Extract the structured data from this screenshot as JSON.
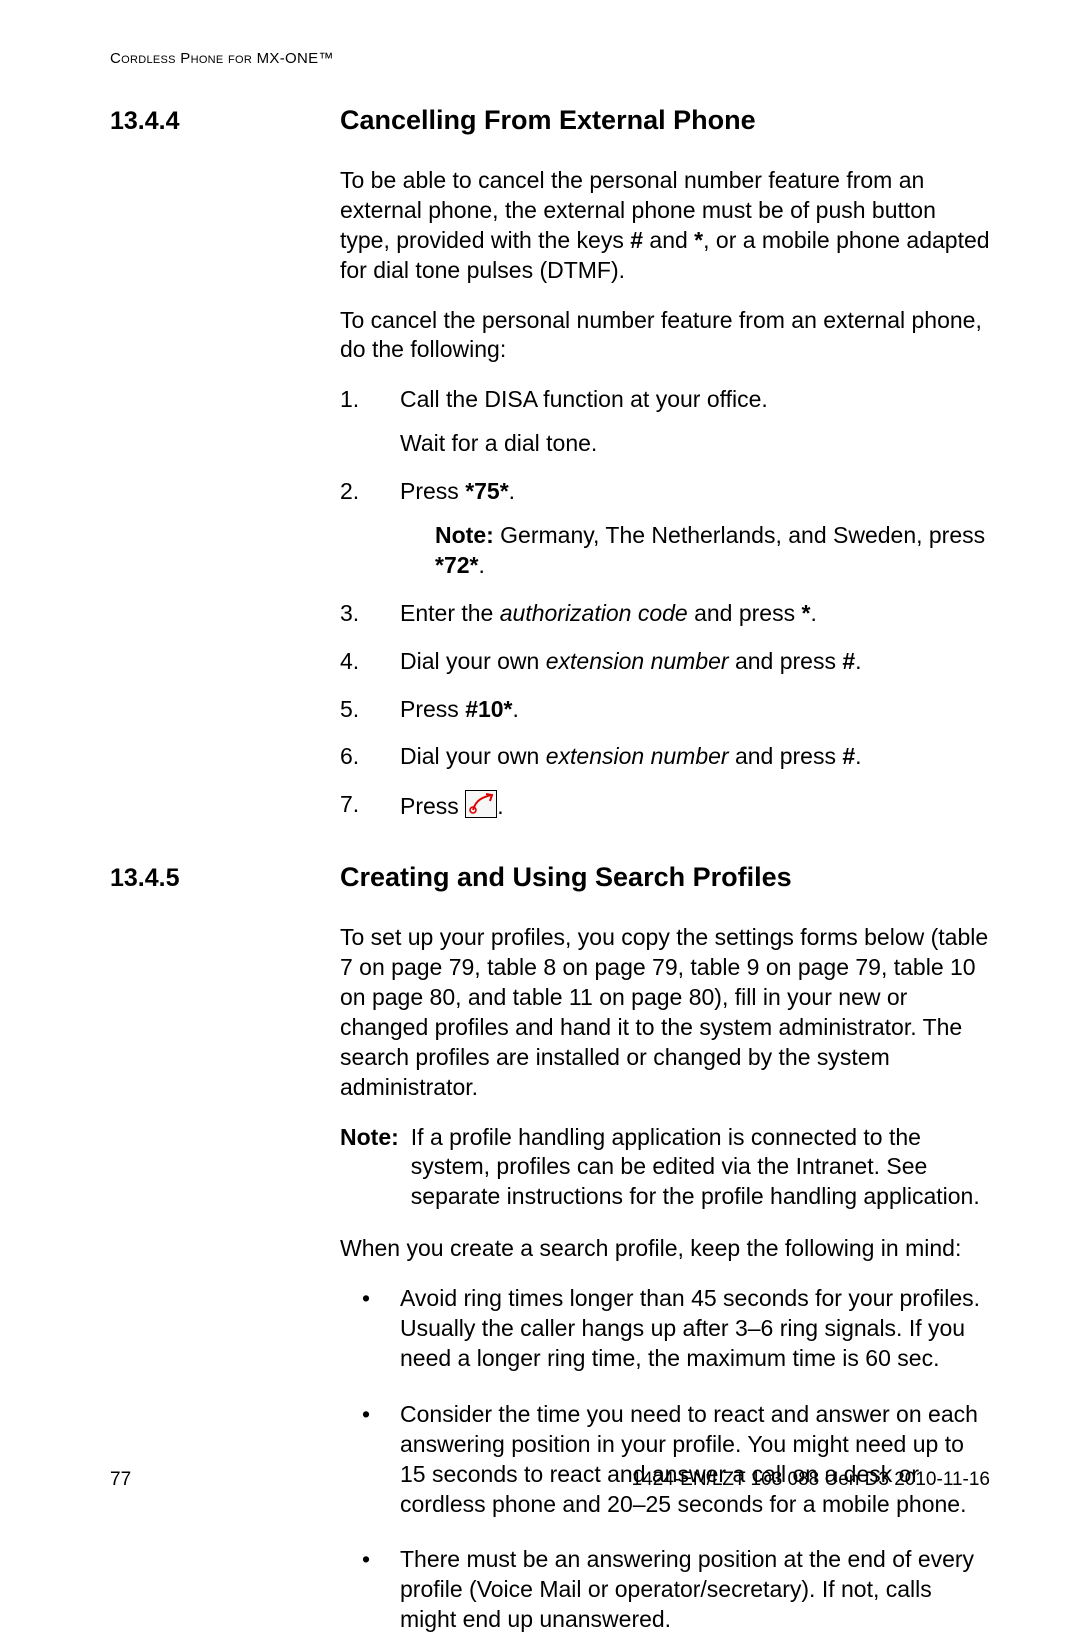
{
  "running_head": "Cordless Phone for MX-ONE™",
  "sections": {
    "s1": {
      "num": "13.4.4",
      "title": "Cancelling From External Phone",
      "intro1_a": "To be able to cancel the personal number feature from an external phone, the external phone must be of push button type, provided with the keys ",
      "intro1_hash": "#",
      "intro1_and": " and ",
      "intro1_star": "*",
      "intro1_b": ", or a mobile phone adapted for dial tone pulses (DTMF).",
      "intro2": "To cancel the personal number feature from an external phone, do the following:",
      "steps": {
        "s1_num": "1.",
        "s1_text": "Call the DISA function at your office.",
        "s1_sub": "Wait for a dial tone.",
        "s2_num": "2.",
        "s2_text_a": "Press ",
        "s2_code": "*75*",
        "s2_text_b": ".",
        "s2_note_label": "Note:",
        "s2_note_a": "  Germany, The Netherlands, and Sweden, press ",
        "s2_note_code": "*72*",
        "s2_note_b": ".",
        "s3_num": "3.",
        "s3_a": "Enter the ",
        "s3_i": "authorization code",
        "s3_b": " and press ",
        "s3_c": "*",
        "s3_d": ".",
        "s4_num": "4.",
        "s4_a": "Dial your own ",
        "s4_i": "extension number",
        "s4_b": " and press ",
        "s4_c": "#",
        "s4_d": ".",
        "s5_num": "5.",
        "s5_a": "Press ",
        "s5_code": "#10*",
        "s5_b": ".",
        "s6_num": "6.",
        "s6_a": "Dial your own ",
        "s6_i": "extension number",
        "s6_b": " and press ",
        "s6_c": "#",
        "s6_d": ".",
        "s7_num": "7.",
        "s7_a": "Press ",
        "s7_b": "."
      }
    },
    "s2": {
      "num": "13.4.5",
      "title": "Creating and Using Search Profiles",
      "intro1": "To set up your profiles, you copy the settings forms below (table 7 on page 79, table 8 on page 79, table 9 on page 79, table 10 on page 80, and table 11 on page 80), fill in your new or changed profiles and hand it to the system administrator. The search profiles are installed or changed by the system administrator.",
      "note_label": "Note:",
      "note_text": "If a profile handling application is connected to the system, profiles can be edited via the Intranet. See separate instructions for the profile handling application.",
      "intro2": "When you create a search profile, keep the following in mind:",
      "bullets": {
        "b1": "Avoid ring times longer than 45 seconds for your profiles. Usually the caller hangs up after 3–6 ring signals. If you need a longer ring time, the maximum time is 60 sec.",
        "b2": "Consider the time you need to react and answer on each answering position in your profile. You might need up to 15 seconds to react and answer a call on a desk or cordless phone and 20–25 seconds for a mobile phone.",
        "b3": "There must be an answering position at the end of every profile (Voice Mail or operator/secretary). If not, calls might end up unanswered."
      }
    }
  },
  "footer": {
    "page": "77",
    "docid": "1424-EN/LZT 103 088 Uen D3 2010-11-16"
  }
}
